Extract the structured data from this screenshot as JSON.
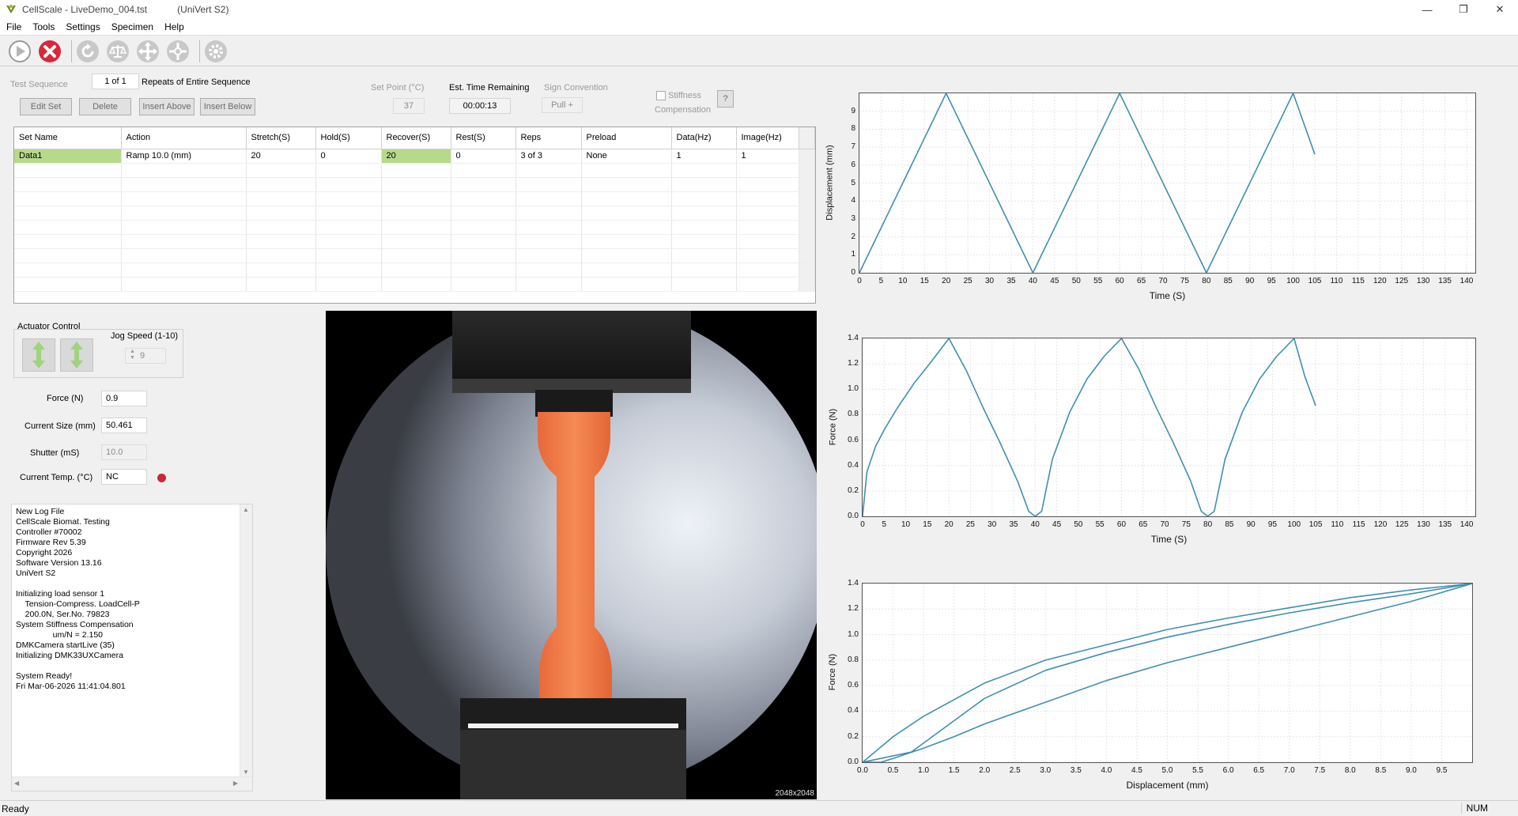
{
  "window": {
    "title": "CellScale - LiveDemo_004.tst",
    "subtitle": "(UniVert S2)"
  },
  "menu": [
    "File",
    "Tools",
    "Settings",
    "Specimen",
    "Help"
  ],
  "toolbar": {
    "icons": [
      "play-icon",
      "stop-icon",
      "refresh-icon",
      "balance-icon",
      "arrows-expand-icon",
      "arrows-reset-icon",
      "gear-icon"
    ]
  },
  "sequence": {
    "label": "Test Sequence",
    "count": "1 of 1",
    "repeats_label": "Repeats of Entire Sequence",
    "buttons": {
      "edit": "Edit Set",
      "delete": "Delete",
      "insert_above": "Insert Above",
      "insert_below": "Insert Below"
    }
  },
  "setpoint": {
    "label": "Set Point (°C)",
    "value": "37"
  },
  "time_remaining": {
    "label": "Est. Time Remaining",
    "value": "00:00:13"
  },
  "sign": {
    "label": "Sign Convention",
    "value": "Pull +"
  },
  "stiffness": {
    "label1": "Stiffness",
    "label2": "Compensation",
    "help": "?"
  },
  "table": {
    "headers": [
      "Set Name",
      "Action",
      "Stretch(S)",
      "Hold(S)",
      "Recover(S)",
      "Rest(S)",
      "Reps",
      "Preload",
      "Data(Hz)",
      "Image(Hz)"
    ],
    "rows": [
      [
        "Data1",
        "Ramp 10.0 (mm)",
        "20",
        "0",
        "20",
        "0",
        "3 of 3",
        "None",
        "1",
        "1"
      ]
    ]
  },
  "actuator": {
    "title": "Actuator Control",
    "jog_label": "Jog Speed (1-10)",
    "jog_value": "9"
  },
  "readouts": {
    "force": {
      "label": "Force (N)",
      "value": "0.9"
    },
    "size": {
      "label": "Current Size (mm)",
      "value": "50.461"
    },
    "shutter": {
      "label": "Shutter (mS)",
      "value": "10.0"
    },
    "temp": {
      "label": "Current Temp. (°C)",
      "value": "NC"
    }
  },
  "colors": {
    "accent": "#3f8fb0",
    "temp_indicator": "#c8283c",
    "specimen": "#f07a48",
    "grid_highlight": "#b7d98c"
  },
  "log": "New Log File\nCellScale Biomat. Testing\nController #70002\nFirmware Rev 5.39\nCopyright 2026\nSoftware Version 13.16\nUniVert S2\n\nInitializing load sensor 1\n    Tension-Compress. LoadCell-P\n    200.0N, Ser.No. 79823\nSystem Stiffness Compensation\n                um/N = 2.150\nDMKCamera startLive (35)\nInitializing DMK33UXCamera\n\nSystem Ready!\nFri Mar-06-2026 11:41:04.801",
  "camera": {
    "resolution": "2048x2048"
  },
  "status": {
    "left": "Ready",
    "right": "NUM"
  },
  "chart_data": [
    {
      "type": "line",
      "xlabel": "Time (S)",
      "ylabel": "Displacement (mm)",
      "xlim": [
        0,
        142
      ],
      "ylim": [
        0,
        10
      ],
      "xticks": [
        0,
        5,
        10,
        15,
        20,
        25,
        30,
        35,
        40,
        45,
        50,
        55,
        60,
        65,
        70,
        75,
        80,
        85,
        90,
        95,
        100,
        105,
        110,
        115,
        120,
        125,
        130,
        135,
        140
      ],
      "yticks": [
        0,
        1,
        2,
        3,
        4,
        5,
        6,
        7,
        8,
        9
      ],
      "series": [
        {
          "x": [
            0,
            20,
            40,
            60,
            80,
            100,
            105
          ],
          "y": [
            0,
            10,
            0,
            10,
            0,
            10,
            6.6
          ]
        }
      ]
    },
    {
      "type": "line",
      "xlabel": "Time (S)",
      "ylabel": "Force (N)",
      "xlim": [
        0,
        142
      ],
      "ylim": [
        0,
        1.4
      ],
      "xticks": [
        0,
        5,
        10,
        15,
        20,
        25,
        30,
        35,
        40,
        45,
        50,
        55,
        60,
        65,
        70,
        75,
        80,
        85,
        90,
        95,
        100,
        105,
        110,
        115,
        120,
        125,
        130,
        135,
        140
      ],
      "yticks": [
        0.0,
        0.2,
        0.4,
        0.6,
        0.8,
        1.0,
        1.2,
        1.4
      ],
      "series": [
        {
          "x": [
            0,
            1,
            3,
            5,
            8,
            12,
            16,
            20,
            24,
            28,
            32,
            36,
            38.5,
            40,
            41.5,
            44,
            48,
            52,
            56,
            60,
            64,
            68,
            72,
            76,
            78.5,
            80,
            81.5,
            84,
            88,
            92,
            96,
            100,
            102.5,
            105
          ],
          "y": [
            0.0,
            0.35,
            0.55,
            0.68,
            0.85,
            1.05,
            1.22,
            1.4,
            1.15,
            0.85,
            0.57,
            0.27,
            0.04,
            0.0,
            0.04,
            0.45,
            0.82,
            1.08,
            1.26,
            1.4,
            1.16,
            0.86,
            0.58,
            0.28,
            0.04,
            0.0,
            0.04,
            0.45,
            0.82,
            1.08,
            1.26,
            1.4,
            1.1,
            0.87
          ]
        }
      ]
    },
    {
      "type": "line",
      "xlabel": "Displacement (mm)",
      "ylabel": "Force (N)",
      "xlim": [
        0,
        10
      ],
      "ylim": [
        0,
        1.4
      ],
      "xticks": [
        0.0,
        0.5,
        1.0,
        1.5,
        2.0,
        2.5,
        3.0,
        3.5,
        4.0,
        4.5,
        5.0,
        5.5,
        6.0,
        6.5,
        7.0,
        7.5,
        8.0,
        8.5,
        9.0,
        9.5
      ],
      "yticks": [
        0.0,
        0.2,
        0.4,
        0.6,
        0.8,
        1.0,
        1.2,
        1.4
      ],
      "series": [
        {
          "x": [
            0,
            0.5,
            1.0,
            2.0,
            3.0,
            4.0,
            5.0,
            6.0,
            7.0,
            8.0,
            9.0,
            10.0
          ],
          "y": [
            0,
            0.2,
            0.36,
            0.62,
            0.8,
            0.92,
            1.04,
            1.13,
            1.21,
            1.29,
            1.35,
            1.4
          ]
        },
        {
          "x": [
            10.0,
            9.0,
            8.0,
            7.0,
            6.0,
            5.0,
            4.0,
            3.0,
            2.0,
            1.5,
            1.0,
            0.5,
            0.3,
            0
          ],
          "y": [
            1.4,
            1.26,
            1.14,
            1.02,
            0.9,
            0.78,
            0.64,
            0.47,
            0.3,
            0.2,
            0.11,
            0.03,
            0.0,
            0.0
          ]
        },
        {
          "x": [
            0,
            0.8,
            1.2,
            2.0,
            3.0,
            4.0,
            5.0,
            6.0,
            7.0,
            8.0,
            9.0,
            10.0
          ],
          "y": [
            0,
            0.08,
            0.22,
            0.5,
            0.72,
            0.86,
            0.98,
            1.08,
            1.17,
            1.25,
            1.32,
            1.4
          ]
        }
      ]
    }
  ]
}
